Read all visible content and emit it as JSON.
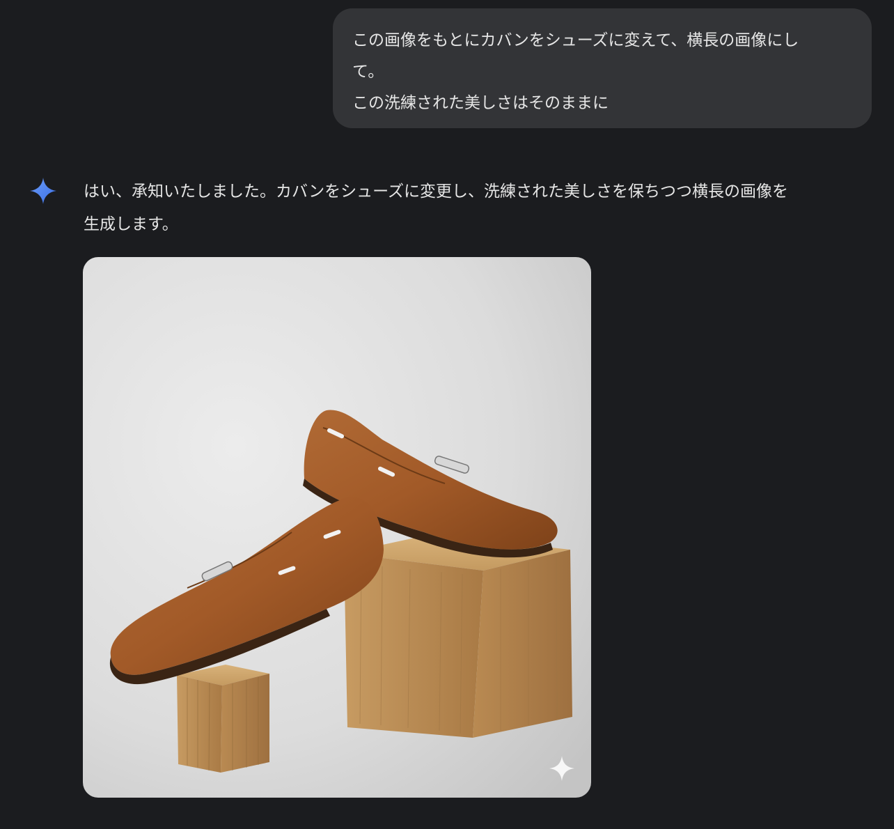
{
  "user_message": {
    "lines": [
      "この画像をもとにカバンをシューズに変えて、横長の画像にし",
      "て。",
      "この洗練された美しさはそのままに"
    ]
  },
  "assistant_message": {
    "icon": "gemini-sparkle-icon",
    "lines": [
      "はい、承知いたしました。カバンをシューズに変更し、洗練された美しさを保ちつつ横長の画像を",
      "生成します。"
    ]
  },
  "generated_image": {
    "subject": "brown leather loafers on wooden blocks",
    "watermark_icon": "sparkle-watermark-icon"
  },
  "colors": {
    "background": "#1b1c1f",
    "user_bubble": "#333437",
    "text": "#e6e6e6",
    "accent_blue": "#4f8cf7"
  }
}
